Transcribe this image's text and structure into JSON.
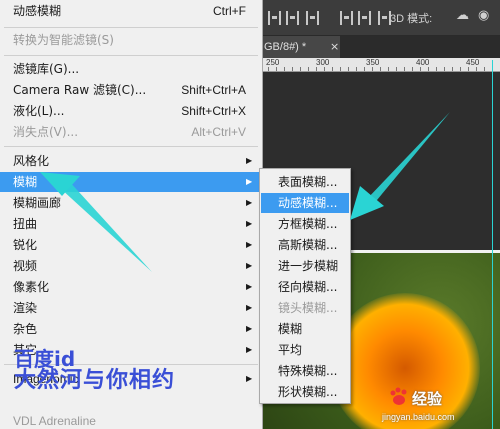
{
  "menu": {
    "items": [
      {
        "label": "动感模糊",
        "shortcut": "Ctrl+F",
        "disabled": false,
        "submenu": false,
        "highlighted": false
      },
      {
        "label": "转换为智能滤镜(S)",
        "shortcut": "",
        "disabled": true,
        "submenu": false,
        "highlighted": false
      },
      {
        "label": "滤镜库(G)...",
        "shortcut": "",
        "disabled": false,
        "submenu": false,
        "highlighted": false
      },
      {
        "label": "Camera Raw 滤镜(C)...",
        "shortcut": "Shift+Ctrl+A",
        "disabled": false,
        "submenu": false,
        "highlighted": false
      },
      {
        "label": "液化(L)...",
        "shortcut": "Shift+Ctrl+X",
        "disabled": false,
        "submenu": false,
        "highlighted": false
      },
      {
        "label": "消失点(V)...",
        "shortcut": "Alt+Ctrl+V",
        "disabled": true,
        "submenu": false,
        "highlighted": false
      },
      {
        "label": "风格化",
        "shortcut": "",
        "disabled": false,
        "submenu": true,
        "highlighted": false
      },
      {
        "label": "模糊",
        "shortcut": "",
        "disabled": false,
        "submenu": true,
        "highlighted": true
      },
      {
        "label": "模糊画廊",
        "shortcut": "",
        "disabled": false,
        "submenu": true,
        "highlighted": false
      },
      {
        "label": "扭曲",
        "shortcut": "",
        "disabled": false,
        "submenu": true,
        "highlighted": false
      },
      {
        "label": "锐化",
        "shortcut": "",
        "disabled": false,
        "submenu": true,
        "highlighted": false
      },
      {
        "label": "视频",
        "shortcut": "",
        "disabled": false,
        "submenu": true,
        "highlighted": false
      },
      {
        "label": "像素化",
        "shortcut": "",
        "disabled": false,
        "submenu": true,
        "highlighted": false
      },
      {
        "label": "渲染",
        "shortcut": "",
        "disabled": false,
        "submenu": true,
        "highlighted": false
      },
      {
        "label": "杂色",
        "shortcut": "",
        "disabled": false,
        "submenu": true,
        "highlighted": false
      },
      {
        "label": "其它",
        "shortcut": "",
        "disabled": false,
        "submenu": true,
        "highlighted": false
      },
      {
        "label": "Imagenomic",
        "shortcut": "",
        "disabled": false,
        "submenu": true,
        "highlighted": false
      },
      {
        "label": "VDL Adrenaline",
        "shortcut": "",
        "disabled": true,
        "submenu": false,
        "highlighted": false
      }
    ]
  },
  "blur_submenu": {
    "items": [
      {
        "label": "表面模糊...",
        "disabled": false,
        "highlighted": false
      },
      {
        "label": "动感模糊...",
        "disabled": false,
        "highlighted": true
      },
      {
        "label": "方框模糊...",
        "disabled": false,
        "highlighted": false
      },
      {
        "label": "高斯模糊...",
        "disabled": false,
        "highlighted": false
      },
      {
        "label": "进一步模糊",
        "disabled": false,
        "highlighted": false
      },
      {
        "label": "径向模糊...",
        "disabled": false,
        "highlighted": false
      },
      {
        "label": "镜头模糊...",
        "disabled": true,
        "highlighted": false
      },
      {
        "label": "模糊",
        "disabled": false,
        "highlighted": false
      },
      {
        "label": "平均",
        "disabled": false,
        "highlighted": false
      },
      {
        "label": "特殊模糊...",
        "disabled": false,
        "highlighted": false
      },
      {
        "label": "形状模糊...",
        "disabled": false,
        "highlighted": false
      }
    ]
  },
  "options_bar": {
    "mode_label": "3D 模式:"
  },
  "document_tab": {
    "title": "GB/8#) *",
    "close": "×"
  },
  "ruler": {
    "labels": [
      "250",
      "300",
      "350",
      "400",
      "450"
    ]
  },
  "watermark": {
    "brand_line1": "百度id",
    "brand_line2": "大然河与你相约",
    "site_name": "经验",
    "site_url": "jingyan.baidu.com"
  },
  "colors": {
    "menu_highlight": "#3c9bf0",
    "annotation_arrow": "#2ad4d4",
    "watermark_text": "#3a4fd6"
  },
  "icons": {
    "submenu_arrow": "triangle-right-icon",
    "rotate_3d": "rotate-3d-icon"
  }
}
